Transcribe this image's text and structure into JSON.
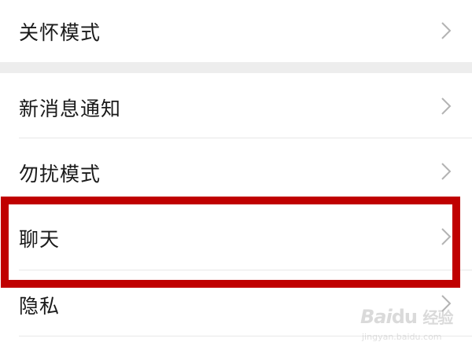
{
  "settings": {
    "items": [
      {
        "label": "关怀模式",
        "icon": "chevron-right-icon"
      },
      {
        "label": "新消息通知",
        "icon": "chevron-right-icon"
      },
      {
        "label": "勿扰模式",
        "icon": "chevron-right-icon"
      },
      {
        "label": "聊天",
        "icon": "chevron-right-icon",
        "highlighted": true
      },
      {
        "label": "隐私",
        "icon": "chevron-right-icon"
      }
    ]
  },
  "colors": {
    "highlight": "#c00000",
    "section_gap": "#ededed",
    "text": "#1a1a1a",
    "chevron": "#b3b3b3"
  },
  "watermark": {
    "brand": "Bai",
    "brand_suffix": "经验",
    "url": "jingyan.baidu.com"
  }
}
